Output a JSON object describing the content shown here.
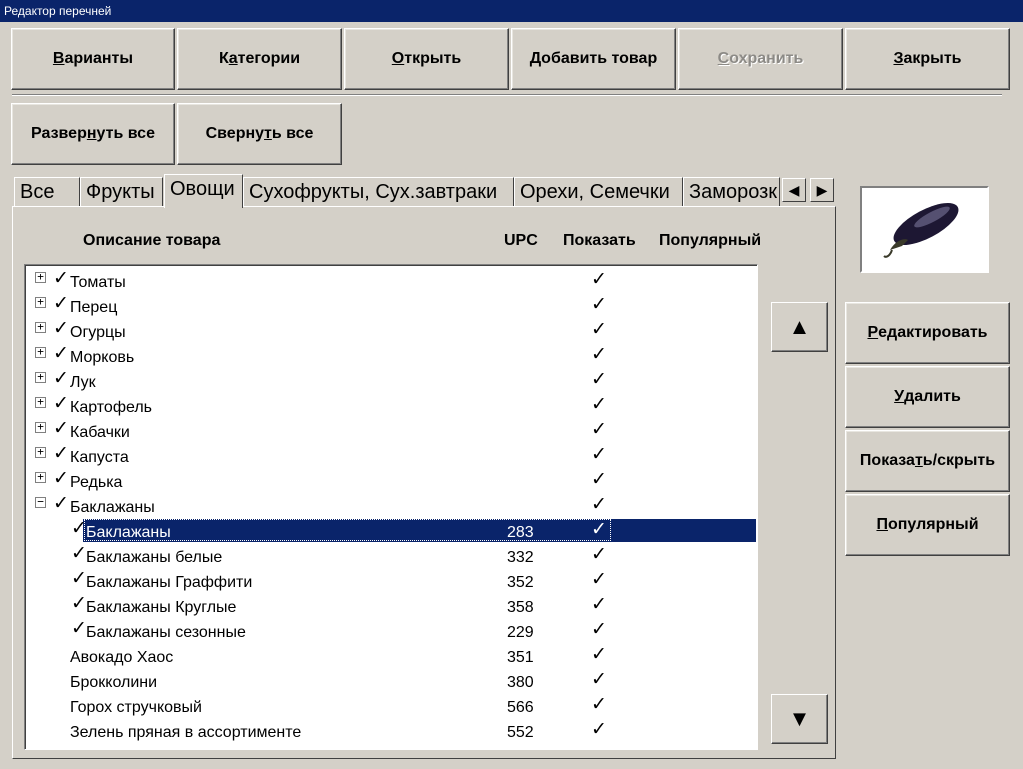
{
  "window": {
    "title": "Редактор перечней"
  },
  "toolbar": {
    "variants": {
      "pre": "",
      "u": "В",
      "post": "арианты"
    },
    "categories": {
      "pre": "К",
      "u": "а",
      "post": "тегории"
    },
    "open": {
      "pre": "",
      "u": "О",
      "post": "ткрыть"
    },
    "add_product": {
      "pre": "",
      "u": "Д",
      "post": "обавить товар"
    },
    "save": {
      "pre": "",
      "u": "С",
      "post": "охранить"
    },
    "close": {
      "pre": "",
      "u": "З",
      "post": "акрыть"
    }
  },
  "tree_buttons": {
    "expand_all": {
      "pre": "Развер",
      "u": "н",
      "post": "уть все"
    },
    "collapse_all": {
      "pre": "Сверну",
      "u": "т",
      "post": "ь все"
    }
  },
  "tabs": [
    {
      "label": "Все"
    },
    {
      "label": "Фрукты"
    },
    {
      "label": "Овощи"
    },
    {
      "label": "Сухофрукты, Сух.завтраки"
    },
    {
      "label": "Орехи, Семечки"
    },
    {
      "label": "Заморозк"
    }
  ],
  "columns": {
    "description": "Описание товара",
    "upc": "UPC",
    "show": "Показать",
    "popular": "Популярный"
  },
  "check_glyph": "✓",
  "rows": [
    {
      "name": "Томаты",
      "upc": "",
      "show": true,
      "level": 0,
      "expander": "+",
      "checked": true
    },
    {
      "name": "Перец",
      "upc": "",
      "show": true,
      "level": 0,
      "expander": "+",
      "checked": true
    },
    {
      "name": "Огурцы",
      "upc": "",
      "show": true,
      "level": 0,
      "expander": "+",
      "checked": true
    },
    {
      "name": "Морковь",
      "upc": "",
      "show": true,
      "level": 0,
      "expander": "+",
      "checked": true
    },
    {
      "name": "Лук",
      "upc": "",
      "show": true,
      "level": 0,
      "expander": "+",
      "checked": true
    },
    {
      "name": "Картофель",
      "upc": "",
      "show": true,
      "level": 0,
      "expander": "+",
      "checked": true
    },
    {
      "name": "Кабачки",
      "upc": "",
      "show": true,
      "level": 0,
      "expander": "+",
      "checked": true
    },
    {
      "name": "Капуста",
      "upc": "",
      "show": true,
      "level": 0,
      "expander": "+",
      "checked": true
    },
    {
      "name": "Редька",
      "upc": "",
      "show": true,
      "level": 0,
      "expander": "+",
      "checked": true
    },
    {
      "name": "Баклажаны",
      "upc": "",
      "show": true,
      "level": 0,
      "expander": "−",
      "checked": true
    },
    {
      "name": "Баклажаны",
      "upc": "283",
      "show": true,
      "level": 1,
      "expander": "",
      "checked": true,
      "selected": true
    },
    {
      "name": "Баклажаны белые",
      "upc": "332",
      "show": true,
      "level": 1,
      "expander": "",
      "checked": true
    },
    {
      "name": "Баклажаны Граффити",
      "upc": "352",
      "show": true,
      "level": 1,
      "expander": "",
      "checked": true
    },
    {
      "name": "Баклажаны Круглые",
      "upc": "358",
      "show": true,
      "level": 1,
      "expander": "",
      "checked": true
    },
    {
      "name": "Баклажаны сезонные",
      "upc": "229",
      "show": true,
      "level": 1,
      "expander": "",
      "checked": true
    },
    {
      "name": "Авокадо Хаос",
      "upc": "351",
      "show": true,
      "level": 0,
      "expander": "",
      "checked": false
    },
    {
      "name": "Брокколини",
      "upc": "380",
      "show": true,
      "level": 0,
      "expander": "",
      "checked": false
    },
    {
      "name": "Горох стручковый",
      "upc": "566",
      "show": true,
      "level": 0,
      "expander": "",
      "checked": false
    },
    {
      "name": "Зелень пряная в ассортименте",
      "upc": "552",
      "show": true,
      "level": 0,
      "expander": "",
      "checked": false
    }
  ],
  "scroll": {
    "up": "▲",
    "down": "▼"
  },
  "tab_scroll": {
    "left": "◀",
    "right": "▶"
  },
  "actions": {
    "edit": {
      "pre": "",
      "u": "Р",
      "post": "едактировать"
    },
    "delete": {
      "pre": "",
      "u": "У",
      "post": "далить"
    },
    "show_hide": {
      "pre": "Показа",
      "u": "т",
      "post": "ь/скрыть"
    },
    "popular": {
      "pre": "",
      "u": "П",
      "post": "опулярный"
    }
  },
  "product_image": {
    "subject": "eggplant",
    "color": "#1a1530"
  }
}
